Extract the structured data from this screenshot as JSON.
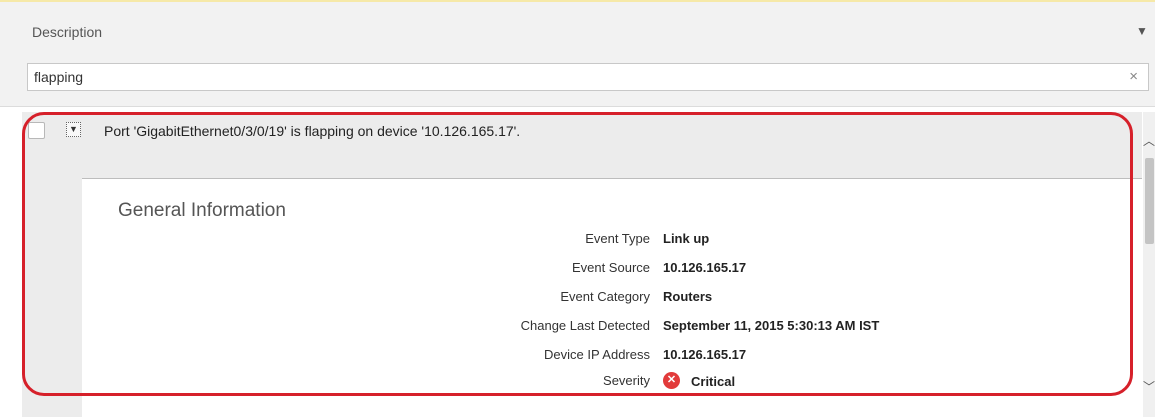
{
  "column": {
    "title": "Description",
    "menu_glyph": "▼"
  },
  "filter": {
    "value": "flapping",
    "clear_glyph": "×"
  },
  "row": {
    "toggle_glyph": "▼",
    "text": "Port 'GigabitEthernet0/3/0/19' is flapping on device '10.126.165.17'."
  },
  "details": {
    "section_title": "General Information",
    "fields": [
      {
        "label": "Event Type",
        "value": "Link up"
      },
      {
        "label": "Event Source",
        "value": "10.126.165.17"
      },
      {
        "label": "Event Category",
        "value": "Routers"
      },
      {
        "label": "Change Last Detected",
        "value": "September 11, 2015 5:30:13 AM IST"
      },
      {
        "label": "Device IP Address",
        "value": "10.126.165.17"
      },
      {
        "label": "Severity",
        "value": "Critical"
      }
    ],
    "severity_icon": "critical-x-icon",
    "severity_color": "#e23b3b"
  },
  "highlight_color": "#d6202a"
}
